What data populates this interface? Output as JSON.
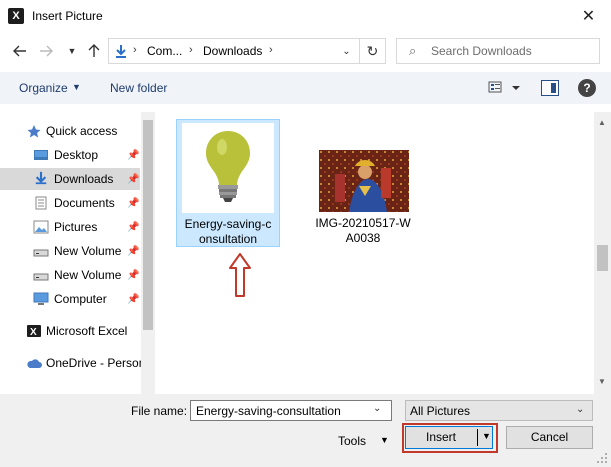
{
  "window": {
    "title": "Insert Picture",
    "app_icon_letter": "X"
  },
  "nav": {
    "address_segments": [
      "Com...",
      "Downloads"
    ],
    "search_placeholder": "Search Downloads"
  },
  "toolbar": {
    "organize_label": "Organize",
    "new_folder_label": "New folder"
  },
  "sidebar": {
    "items": [
      {
        "label": "Quick access",
        "icon": "star-icon",
        "pinned": false
      },
      {
        "label": "Desktop",
        "icon": "desktop-folder-icon",
        "pinned": true
      },
      {
        "label": "Downloads",
        "icon": "download-arrow-icon",
        "pinned": true,
        "selected": true
      },
      {
        "label": "Documents",
        "icon": "documents-icon",
        "pinned": true
      },
      {
        "label": "Pictures",
        "icon": "pictures-icon",
        "pinned": true
      },
      {
        "label": "New Volume",
        "icon": "drive-icon",
        "pinned": true
      },
      {
        "label": "New Volume",
        "icon": "drive-icon",
        "pinned": true
      },
      {
        "label": "Computer",
        "icon": "computer-icon",
        "pinned": true
      },
      {
        "label": "Microsoft Excel",
        "icon": "excel-icon",
        "pinned": false
      },
      {
        "label": "OneDrive - Person",
        "icon": "cloud-icon",
        "pinned": false
      }
    ]
  },
  "files": [
    {
      "name_line1": "Energy-saving-c",
      "name_line2": "onsultation",
      "thumbnail": "light-bulb-icon",
      "selected": true
    },
    {
      "name_line1": "IMG-20210517-W",
      "name_line2": "A0038",
      "thumbnail": "photo-thumbnail",
      "selected": false
    }
  ],
  "footer": {
    "file_name_label": "File name:",
    "file_name_value": "Energy-saving-consultation",
    "file_type_value": "All Pictures",
    "tools_label": "Tools",
    "insert_label": "Insert",
    "cancel_label": "Cancel"
  },
  "colors": {
    "selection_bg": "#cce8ff",
    "accent_blue": "#0078d7",
    "highlight_red": "#c0392b",
    "command_bar_bg": "#f0f4f9"
  }
}
